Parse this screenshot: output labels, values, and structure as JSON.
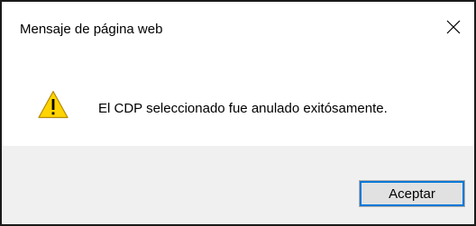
{
  "dialog": {
    "title": "Mensaje de página web",
    "message": "El CDP seleccionado fue anulado exitósamente.",
    "ok_label": "Aceptar",
    "icon": "warning-icon",
    "close_icon": "close-icon"
  },
  "colors": {
    "warning_fill": "#ffd400",
    "warning_outline": "#b58a00",
    "footer_bg": "#f0f0f0",
    "button_bg": "#e1e1e1",
    "button_focus": "#0078d7",
    "border": "#1a1a1a"
  }
}
